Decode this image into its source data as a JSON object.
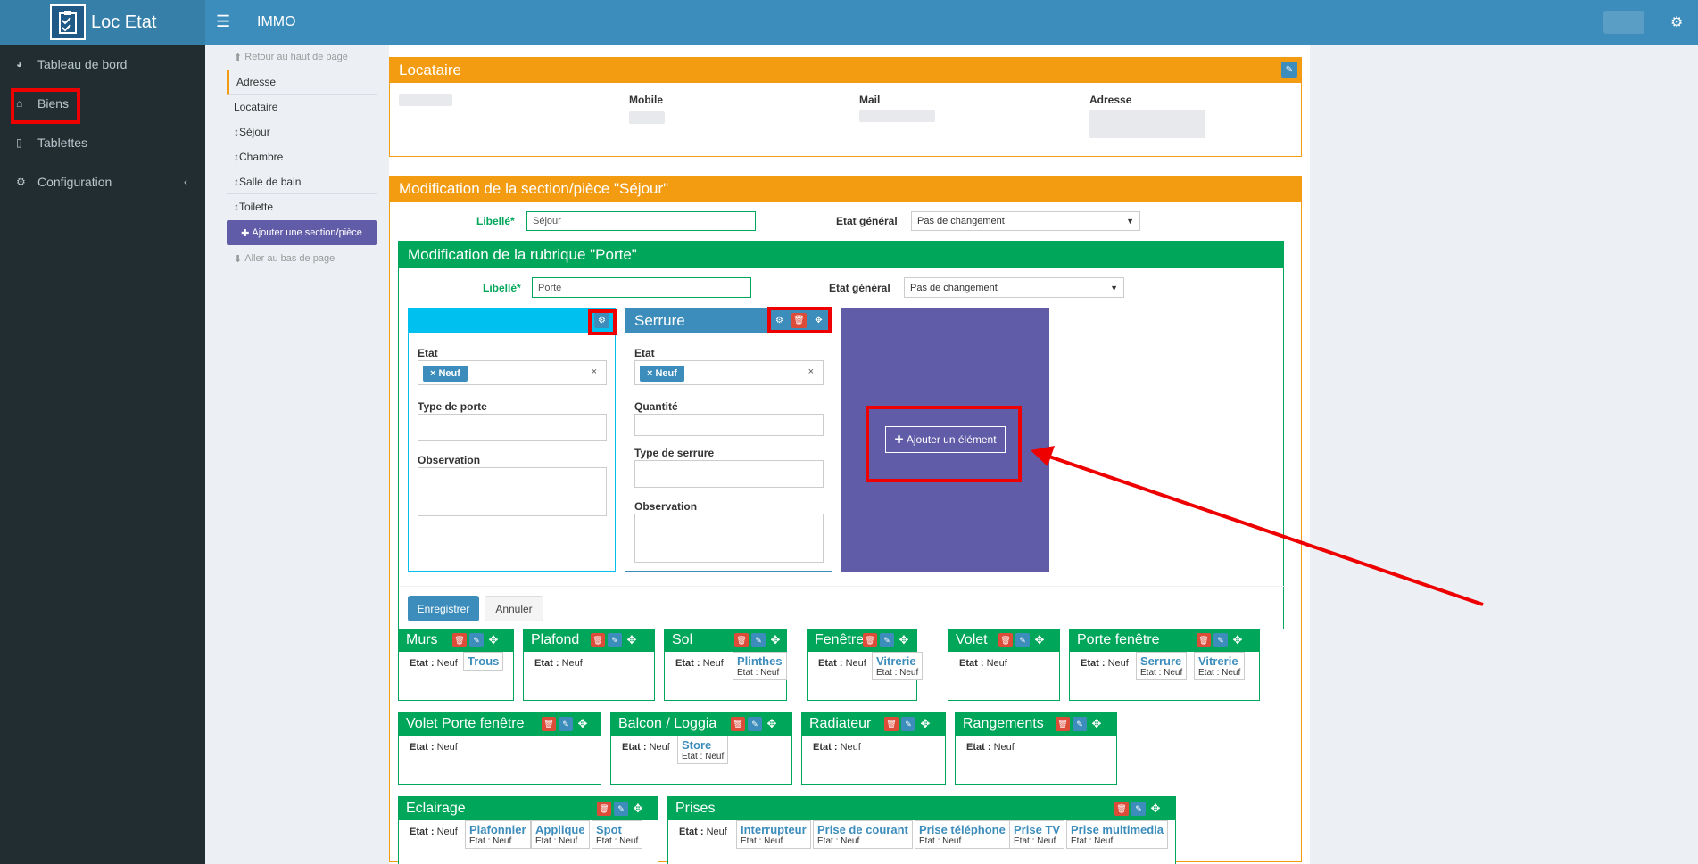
{
  "header": {
    "logo": "Loc Etat",
    "app": "IMMO"
  },
  "sidebar": {
    "items": [
      {
        "label": "Tableau de bord",
        "icon": "dashboard-icon"
      },
      {
        "label": "Biens",
        "icon": "home-icon"
      },
      {
        "label": "Tablettes",
        "icon": "tablet-icon"
      },
      {
        "label": "Configuration",
        "icon": "cogs-icon"
      }
    ]
  },
  "subnav": {
    "top": "Retour au haut de page",
    "items": [
      "Adresse",
      "Locataire",
      "Séjour",
      "Chambre",
      "Salle de bain",
      "Toilette"
    ],
    "add": "Ajouter une section/pièce",
    "bottom": "Aller au bas de page"
  },
  "locataire": {
    "title": "Locataire",
    "cols": [
      "Mobile",
      "Mail",
      "Adresse"
    ]
  },
  "section": {
    "title": "Modification de la section/pièce \"Séjour\"",
    "libelle_label": "Libellé*",
    "libelle_value": "Séjour",
    "etat_label": "Etat général",
    "etat_value": "Pas de changement"
  },
  "modal": {
    "title": "Modification de la rubrique \"Porte\"",
    "libelle_label": "Libellé*",
    "libelle_value": "Porte",
    "etat_label": "Etat général",
    "etat_value": "Pas de changement",
    "save": "Enregistrer",
    "cancel": "Annuler",
    "card1": {
      "etat": "Etat",
      "tag": "Neuf",
      "f1": "Type de porte",
      "f2": "Observation"
    },
    "card2": {
      "title": "Serrure",
      "etat": "Etat",
      "tag": "Neuf",
      "f1": "Quantité",
      "f2": "Type de serrure",
      "f3": "Observation"
    },
    "add": "Ajouter un élément"
  },
  "etat_label": "Etat :",
  "etat_val": "Neuf",
  "rubriques": {
    "murs": {
      "title": "Murs",
      "sub": [
        {
          "n": "Trous"
        }
      ]
    },
    "plafond": {
      "title": "Plafond"
    },
    "sol": {
      "title": "Sol",
      "sub": [
        {
          "n": "Plinthes",
          "s": "Etat : Neuf"
        }
      ]
    },
    "fenetre": {
      "title": "Fenêtre",
      "sub": [
        {
          "n": "Vitrerie",
          "s": "Etat : Neuf"
        }
      ]
    },
    "volet": {
      "title": "Volet"
    },
    "porte_fenetre": {
      "title": "Porte fenêtre",
      "sub": [
        {
          "n": "Serrure",
          "s": "Etat : Neuf"
        },
        {
          "n": "Vitrerie",
          "s": "Etat : Neuf"
        }
      ]
    },
    "volet_pf": {
      "title": "Volet Porte fenêtre"
    },
    "balcon": {
      "title": "Balcon / Loggia",
      "sub": [
        {
          "n": "Store",
          "s": "Etat : Neuf"
        }
      ]
    },
    "radiateur": {
      "title": "Radiateur"
    },
    "rangements": {
      "title": "Rangements"
    },
    "eclairage": {
      "title": "Eclairage",
      "sub": [
        {
          "n": "Plafonnier",
          "s": "Etat : Neuf"
        },
        {
          "n": "Applique",
          "s": "Etat : Neuf"
        },
        {
          "n": "Spot",
          "s": "Etat : Neuf"
        }
      ]
    },
    "prises": {
      "title": "Prises",
      "sub": [
        {
          "n": "Interrupteur",
          "s": "Etat : Neuf"
        },
        {
          "n": "Prise de courant",
          "s": "Etat : Neuf"
        },
        {
          "n": "Prise téléphone",
          "s": "Etat : Neuf"
        },
        {
          "n": "Prise TV",
          "s": "Etat : Neuf"
        },
        {
          "n": "Prise multimedia",
          "s": "Etat : Neuf"
        }
      ]
    }
  },
  "colors": {
    "header": "#3c8dbc",
    "sidebar": "#222d32",
    "orange": "#f39c12",
    "green": "#00a65a",
    "aqua": "#00c0ef",
    "purple": "#605ca8",
    "red": "#dd4b39",
    "annotation": "#ee0000"
  }
}
